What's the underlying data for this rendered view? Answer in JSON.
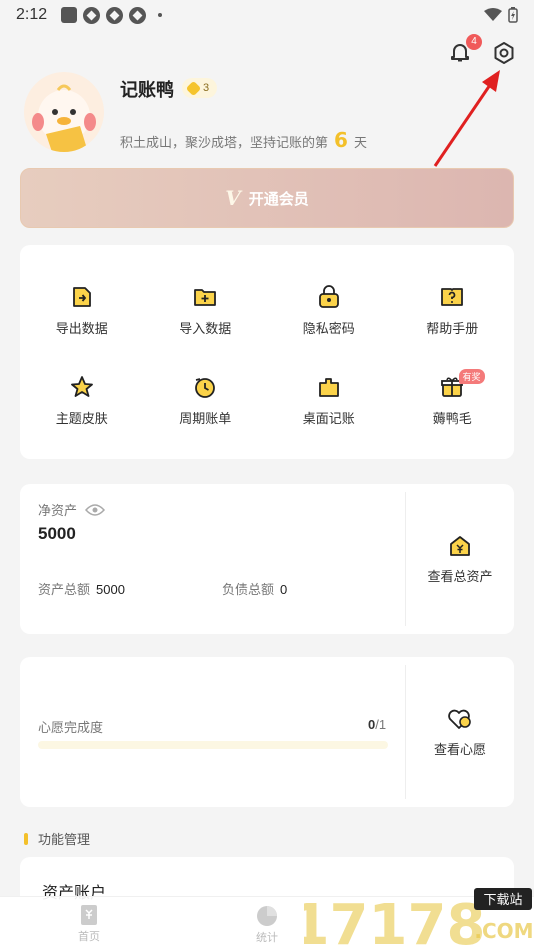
{
  "statusbar": {
    "time": "2:12"
  },
  "header": {
    "notification_count": "4"
  },
  "profile": {
    "name": "记账鸭",
    "level": "3",
    "motto_prefix": "积土成山，聚沙成塔，坚持记账的第",
    "days": "6",
    "motto_suffix": "天"
  },
  "vip": {
    "label": "开通会员"
  },
  "grid": {
    "items": [
      {
        "label": "导出数据",
        "icon": "export-icon"
      },
      {
        "label": "导入数据",
        "icon": "import-icon"
      },
      {
        "label": "隐私密码",
        "icon": "lock-icon"
      },
      {
        "label": "帮助手册",
        "icon": "help-book-icon"
      },
      {
        "label": "主题皮肤",
        "icon": "star-icon"
      },
      {
        "label": "周期账单",
        "icon": "cycle-icon"
      },
      {
        "label": "桌面记账",
        "icon": "desktop-icon"
      },
      {
        "label": "薅鸭毛",
        "icon": "gift-icon",
        "badge": "有奖"
      }
    ]
  },
  "assets": {
    "net_label": "净资产",
    "net_value": "5000",
    "total_assets_label": "资产总额",
    "total_assets_value": "5000",
    "total_debt_label": "负债总额",
    "total_debt_value": "0",
    "view_label": "查看总资产"
  },
  "wish": {
    "label": "心愿完成度",
    "done": "0",
    "total": "/1",
    "progress": 0,
    "view_label": "查看心愿"
  },
  "functions": {
    "section_title": "功能管理",
    "account_title": "资产账户"
  },
  "tabbar": {
    "home": "首页",
    "stats": "统计"
  },
  "watermark": {
    "number": "17178",
    "tag": "下载站",
    "domain": ".COM"
  },
  "colors": {
    "accent": "#f3c02a",
    "badge_red": "#f05a5a",
    "arrow_red": "#e02020"
  }
}
